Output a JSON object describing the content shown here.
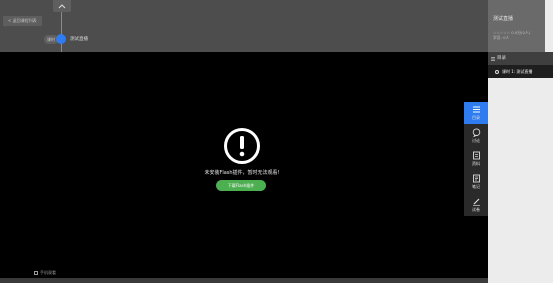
{
  "header": {
    "back_label": "< 返回课程列表",
    "node_tag": "课时",
    "node_label": "测试直播"
  },
  "player": {
    "flash_message": "未安装Flash插件，暂时无法观看!",
    "download_button": "下载Flash插件",
    "mobile_label": "手机观看"
  },
  "side_rail": [
    {
      "label": "目录",
      "icon": "list-icon",
      "active": true
    },
    {
      "label": "讨论",
      "icon": "chat-icon",
      "active": false
    },
    {
      "label": "资料",
      "icon": "document-icon",
      "active": false
    },
    {
      "label": "笔记",
      "icon": "note-icon",
      "active": false
    },
    {
      "label": "试卷",
      "icon": "pencil-icon",
      "active": false
    }
  ],
  "course": {
    "title": "测试直播",
    "meta_line1": "☆☆☆☆☆ 0.0分(0人)",
    "meta_line2": "学员: 0人"
  },
  "toc": {
    "heading": "目录",
    "items": [
      {
        "label": "课时 1: 测试直播"
      }
    ]
  },
  "colors": {
    "accent": "#2f7bf0",
    "download": "#4caf50"
  }
}
